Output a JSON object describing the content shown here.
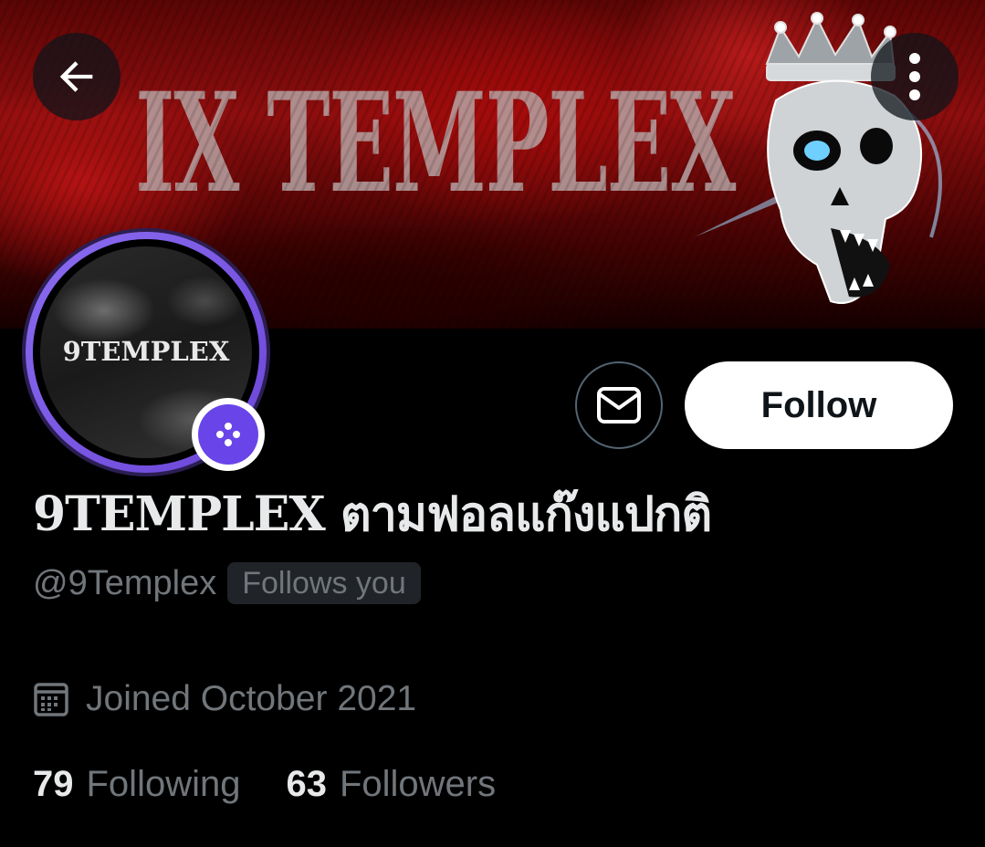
{
  "banner": {
    "title": "IX TEMPLEX",
    "colors": {
      "base": "#8e0e0e",
      "dark": "#160000"
    }
  },
  "header": {
    "back_icon": "arrow-left-icon",
    "more_icon": "more-vertical-icon"
  },
  "avatar": {
    "text": "9TEMPLEX",
    "ring_color": "#7b5ce6",
    "badge_icon": "dice-icon",
    "badge_color": "#6944e8"
  },
  "actions": {
    "message_icon": "envelope-icon",
    "follow_label": "Follow"
  },
  "profile": {
    "display_name": "9TEMPLEX ตามฟอลแก๊งแปกติ",
    "handle": "@9Templex",
    "follows_you": "Follows you",
    "joined_icon": "calendar-icon",
    "joined": "Joined October 2021",
    "following_count": "79",
    "following_label": "Following",
    "followers_count": "63",
    "followers_label": "Followers"
  }
}
